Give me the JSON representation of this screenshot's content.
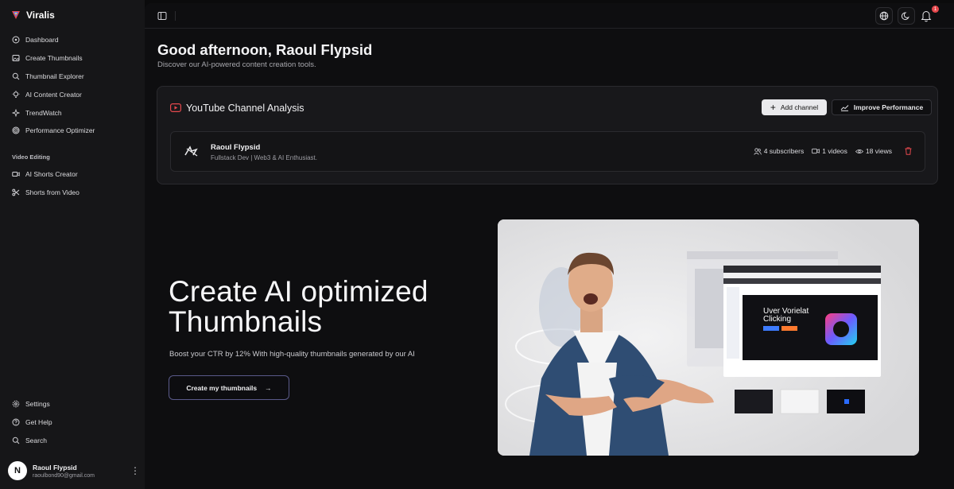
{
  "brand": {
    "name": "Viralis"
  },
  "sidebar": {
    "items": [
      {
        "label": "Dashboard",
        "icon": "dashboard-icon"
      },
      {
        "label": "Create Thumbnails",
        "icon": "image-icon"
      },
      {
        "label": "Thumbnail Explorer",
        "icon": "search-icon"
      },
      {
        "label": "AI Content Creator",
        "icon": "lightbulb-icon"
      },
      {
        "label": "TrendWatch",
        "icon": "sparkle-icon"
      },
      {
        "label": "Performance Optimizer",
        "icon": "target-icon"
      }
    ],
    "section_title": "Video Editing",
    "video_items": [
      {
        "label": "AI Shorts Creator",
        "icon": "video-icon"
      },
      {
        "label": "Shorts from Video",
        "icon": "scissors-icon"
      }
    ],
    "bottom_items": [
      {
        "label": "Settings",
        "icon": "gear-icon"
      },
      {
        "label": "Get Help",
        "icon": "help-icon"
      },
      {
        "label": "Search",
        "icon": "search-icon"
      }
    ],
    "user": {
      "initial": "N",
      "name": "Raoul Flypsid",
      "email": "raoulbond90@gmail.com"
    }
  },
  "topbar": {
    "notification_count": "1"
  },
  "greeting": {
    "title": "Good afternoon, Raoul Flypsid",
    "subtitle": "Discover our AI-powered content creation tools."
  },
  "youtube": {
    "title": "YouTube Channel Analysis",
    "add_label": "Add channel",
    "improve_label": "Improve Performance",
    "channel": {
      "name": "Raoul Flypsid",
      "description": "Fullstack Dev | Web3 & AI Enthusiast.",
      "subscribers": "4 subscribers",
      "videos": "1 videos",
      "views": "18 views"
    }
  },
  "hero": {
    "title_line1": "Create AI optimized",
    "title_line2": "Thumbnails",
    "subtitle": "Boost your CTR by 12% With high-quality thumbnails generated by our AI",
    "cta_label": "Create my thumbnails",
    "cta_arrow": "→",
    "image_text_line1": "Uver Vorielat",
    "image_text_line2": "Clicking"
  },
  "colors": {
    "accent_red": "#e5484d",
    "brand_purple": "#7b5cff"
  }
}
